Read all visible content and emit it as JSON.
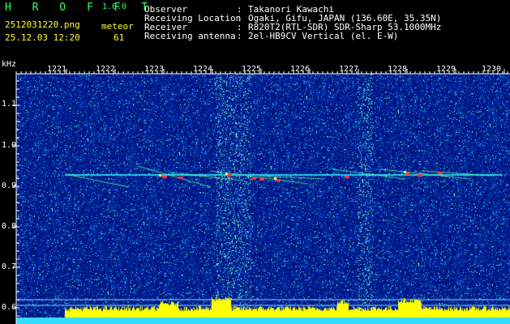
{
  "app": {
    "name": "H R O F F T",
    "version": "1.0.0"
  },
  "file": {
    "name": "2512031220.png",
    "datetime": "25.12.03 12:20"
  },
  "meteor": {
    "label": "meteor",
    "count": "61"
  },
  "info": [
    {
      "key": "Observer",
      "sep": ":",
      "value": "Takanori Kawachi"
    },
    {
      "key": "Receiving Location",
      "sep": ":",
      "value": "Ogaki, Gifu, JAPAN (136.60E, 35.35N)"
    },
    {
      "key": "Receiver",
      "sep": ":",
      "value": "R820T2(RTL-SDR) SDR-Sharp 53.1000MHz"
    },
    {
      "key": "Receiving antenna",
      "sep": ":",
      "value": "2el-HB9CV Vertical (el. E-W)"
    }
  ],
  "axis": {
    "y_unit": "kHz",
    "y_ticks": [
      "1.1",
      "1.0",
      "0.9",
      "0.8",
      "0.7",
      "0.6"
    ],
    "x_ticks": [
      "1221",
      "1222",
      "1223",
      "1224",
      "1225",
      "1226",
      "1227",
      "1228",
      "1229",
      "1230"
    ]
  },
  "colors": {
    "background": "#00117a",
    "signal": "#33ffff",
    "meteor_head": "#ff3333",
    "power": "#ffff00",
    "baseline": "#33ddff"
  }
}
